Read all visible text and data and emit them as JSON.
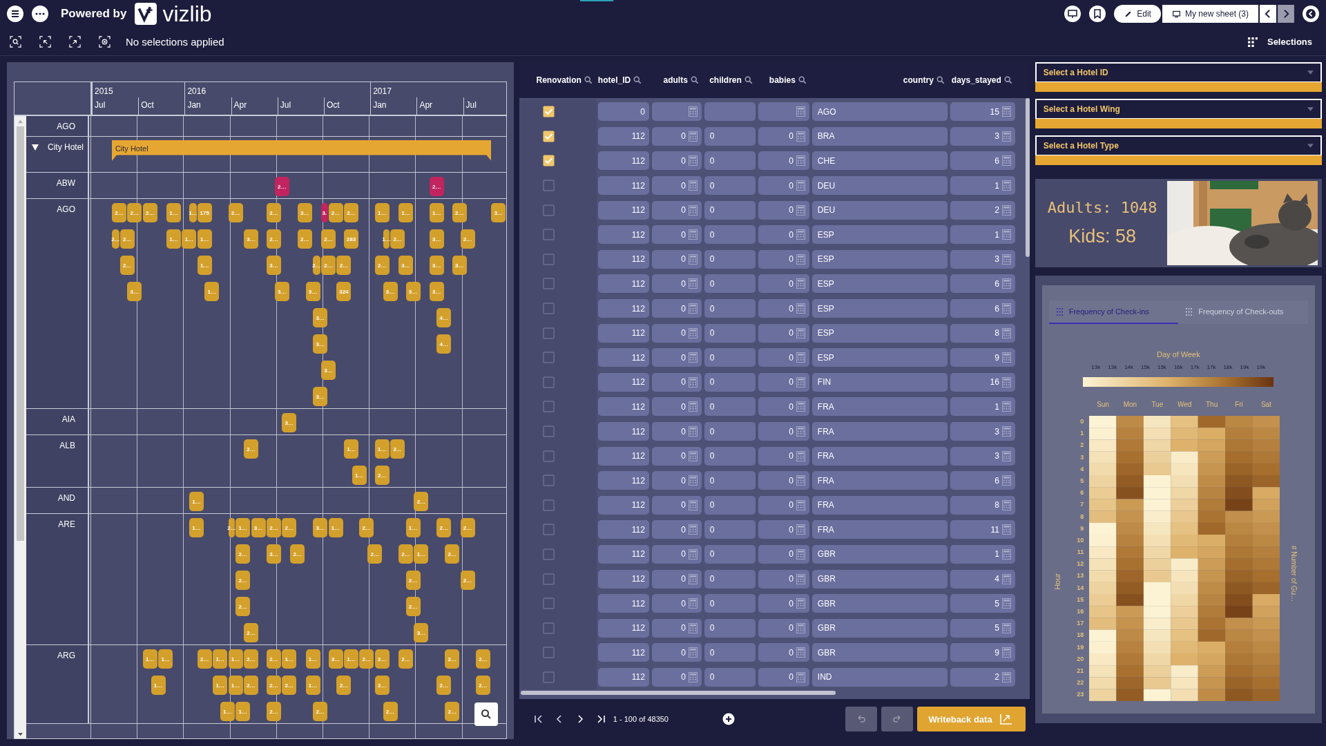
{
  "top_bar": {
    "powered_by": "Powered by",
    "logo_text": "vizlib",
    "edit_label": "Edit",
    "sheet_label": "My new sheet (3)"
  },
  "toolbar": {
    "selection_status": "No selections applied",
    "selections_label": "Selections"
  },
  "gantt": {
    "years": [
      "2015",
      "2016",
      "2017"
    ],
    "months": [
      "Jul",
      "Oct",
      "Jan",
      "Apr",
      "Jul",
      "Oct",
      "Jan",
      "Apr",
      "Jul"
    ],
    "rows": [
      {
        "kind": "country",
        "label": "AGO"
      },
      {
        "kind": "group",
        "label": "City Hotel",
        "expanded": true,
        "group_bar": {
          "label": "City Hotel"
        }
      },
      {
        "kind": "country",
        "label": "ABW",
        "lanes": [
          [
            {
              "label": "2…",
              "color": "#c2245f"
            },
            {
              "label": "2…",
              "color": "#c2245f"
            }
          ]
        ]
      },
      {
        "kind": "country",
        "label": "AGO",
        "lanes": [
          [
            {
              "label": "2…",
              "color": "#d4a02c"
            },
            {
              "label": "2…",
              "color": "#d4a02c"
            },
            {
              "label": "2…",
              "color": "#d4a02c"
            },
            {
              "label": "1…",
              "color": "#d4a02c"
            },
            {
              "label": "1…",
              "color": "#d4a02c"
            },
            {
              "label": "175",
              "color": "#d4a02c"
            },
            {
              "label": "2…",
              "color": "#d4a02c"
            },
            {
              "label": "2…",
              "color": "#d4a02c"
            },
            {
              "label": "3…",
              "color": "#d4a02c"
            },
            {
              "label": "3.",
              "color": "#c2245f"
            },
            {
              "label": "2…",
              "color": "#d4a02c"
            },
            {
              "label": "2…",
              "color": "#d4a02c"
            },
            {
              "label": "1…",
              "color": "#d4a02c"
            },
            {
              "label": "1…",
              "color": "#d4a02c"
            },
            {
              "label": "1…",
              "color": "#d4a02c"
            },
            {
              "label": "2…",
              "color": "#d4a02c"
            },
            {
              "label": "3…",
              "color": "#d4a02c"
            }
          ],
          [
            {
              "label": "2…",
              "color": "#d4a02c"
            },
            {
              "label": "2…",
              "color": "#d4a02c"
            },
            {
              "label": "1…",
              "color": "#d4a02c"
            },
            {
              "label": "1…",
              "color": "#d4a02c"
            },
            {
              "label": "1…",
              "color": "#d4a02c"
            },
            {
              "label": "3…",
              "color": "#d4a02c"
            },
            {
              "label": "2…",
              "color": "#d4a02c"
            },
            {
              "label": "2…",
              "color": "#d4a02c"
            },
            {
              "label": "2…",
              "color": "#d4a02c"
            },
            {
              "label": "283",
              "color": "#d4a02c"
            },
            {
              "label": "1…",
              "color": "#d4a02c"
            },
            {
              "label": "2…",
              "color": "#d4a02c"
            },
            {
              "label": "3…",
              "color": "#d4a02c"
            },
            {
              "label": "2…",
              "color": "#d4a02c"
            }
          ],
          [
            {
              "label": "2…",
              "color": "#d4a02c"
            },
            {
              "label": "1…",
              "color": "#d4a02c"
            },
            {
              "label": "3…",
              "color": "#d4a02c"
            },
            {
              "label": "2…",
              "color": "#d4a02c"
            },
            {
              "label": "2…",
              "color": "#d4a02c"
            },
            {
              "label": "2…",
              "color": "#d4a02c"
            },
            {
              "label": "2…",
              "color": "#d4a02c"
            },
            {
              "label": "3…",
              "color": "#d4a02c"
            },
            {
              "label": "3…",
              "color": "#d4a02c"
            },
            {
              "label": "3…",
              "color": "#d4a02c"
            }
          ],
          [
            {
              "label": "3…",
              "color": "#d4a02c"
            },
            {
              "label": "1…",
              "color": "#d4a02c"
            },
            {
              "label": "3…",
              "color": "#d4a02c"
            },
            {
              "label": "3…",
              "color": "#d4a02c"
            },
            {
              "label": "324",
              "color": "#d4a02c"
            },
            {
              "label": "3…",
              "color": "#d4a02c"
            },
            {
              "label": "3…",
              "color": "#d4a02c"
            },
            {
              "label": "3…",
              "color": "#d4a02c"
            }
          ],
          [
            {
              "label": "3…",
              "color": "#d4a02c"
            },
            {
              "label": "4…",
              "color": "#d4a02c"
            }
          ],
          [
            {
              "label": "3…",
              "color": "#d4a02c"
            },
            {
              "label": "4…",
              "color": "#d4a02c"
            }
          ],
          [
            {
              "label": "3…",
              "color": "#d4a02c"
            }
          ],
          [
            {
              "label": "3…",
              "color": "#d4a02c"
            }
          ]
        ]
      },
      {
        "kind": "country",
        "label": "AIA",
        "lanes": [
          [
            {
              "label": "3…",
              "color": "#d4a02c"
            }
          ]
        ]
      },
      {
        "kind": "country",
        "label": "ALB",
        "lanes": [
          [
            {
              "label": "2…",
              "color": "#d4a02c"
            },
            {
              "label": "1…",
              "color": "#d4a02c"
            },
            {
              "label": "1…",
              "color": "#d4a02c"
            },
            {
              "label": "2…",
              "color": "#d4a02c"
            }
          ],
          [
            {
              "label": "1…",
              "color": "#d4a02c"
            },
            {
              "label": "2…",
              "color": "#d4a02c"
            }
          ]
        ]
      },
      {
        "kind": "country",
        "label": "AND",
        "lanes": [
          [
            {
              "label": "1…",
              "color": "#d4a02c"
            },
            {
              "label": "2…",
              "color": "#d4a02c"
            }
          ]
        ]
      },
      {
        "kind": "country",
        "label": "ARE",
        "lanes": [
          [
            {
              "label": "1…",
              "color": "#d4a02c"
            },
            {
              "label": "2…",
              "color": "#d4a02c"
            },
            {
              "label": "1…",
              "color": "#d4a02c"
            },
            {
              "label": "3…",
              "color": "#d4a02c"
            },
            {
              "label": "2…",
              "color": "#d4a02c"
            },
            {
              "label": "2…",
              "color": "#d4a02c"
            },
            {
              "label": "3…",
              "color": "#d4a02c"
            },
            {
              "label": "1…",
              "color": "#d4a02c"
            },
            {
              "label": "2…",
              "color": "#d4a02c"
            },
            {
              "label": "1…",
              "color": "#d4a02c"
            },
            {
              "label": "2…",
              "color": "#d4a02c"
            },
            {
              "label": "2…",
              "color": "#d4a02c"
            }
          ],
          [
            {
              "label": "2…",
              "color": "#d4a02c"
            },
            {
              "label": "3…",
              "color": "#d4a02c"
            },
            {
              "label": "2…",
              "color": "#d4a02c"
            },
            {
              "label": "2…",
              "color": "#d4a02c"
            },
            {
              "label": "2…",
              "color": "#d4a02c"
            },
            {
              "label": "1…",
              "color": "#d4a02c"
            },
            {
              "label": "2…",
              "color": "#d4a02c"
            }
          ],
          [
            {
              "label": "2…",
              "color": "#d4a02c"
            },
            {
              "label": "2…",
              "color": "#d4a02c"
            },
            {
              "label": "2…",
              "color": "#d4a02c"
            }
          ],
          [
            {
              "label": "2…",
              "color": "#d4a02c"
            },
            {
              "label": "2…",
              "color": "#d4a02c"
            }
          ],
          [
            {
              "label": "2…",
              "color": "#d4a02c"
            },
            {
              "label": "3…",
              "color": "#d4a02c"
            }
          ]
        ]
      },
      {
        "kind": "country",
        "label": "ARG",
        "lanes": [
          [
            {
              "label": "1…",
              "color": "#d4a02c"
            },
            {
              "label": "1…",
              "color": "#d4a02c"
            },
            {
              "label": "2…",
              "color": "#d4a02c"
            },
            {
              "label": "1…",
              "color": "#d4a02c"
            },
            {
              "label": "1…",
              "color": "#d4a02c"
            },
            {
              "label": "2…",
              "color": "#d4a02c"
            },
            {
              "label": "2…",
              "color": "#d4a02c"
            },
            {
              "label": "1…",
              "color": "#d4a02c"
            },
            {
              "label": "1…",
              "color": "#d4a02c"
            },
            {
              "label": "3…",
              "color": "#d4a02c"
            },
            {
              "label": "1…",
              "color": "#d4a02c"
            },
            {
              "label": "2…",
              "color": "#d4a02c"
            },
            {
              "label": "2…",
              "color": "#d4a02c"
            },
            {
              "label": "2…",
              "color": "#d4a02c"
            },
            {
              "label": "2…",
              "color": "#d4a02c"
            },
            {
              "label": "2…",
              "color": "#d4a02c"
            }
          ],
          [
            {
              "label": "1…",
              "color": "#d4a02c"
            },
            {
              "label": "1…",
              "color": "#d4a02c"
            },
            {
              "label": "1…",
              "color": "#d4a02c"
            },
            {
              "label": "2…",
              "color": "#d4a02c"
            },
            {
              "label": "2…",
              "color": "#d4a02c"
            },
            {
              "label": "2…",
              "color": "#d4a02c"
            },
            {
              "label": "1…",
              "color": "#d4a02c"
            },
            {
              "label": "2…",
              "color": "#d4a02c"
            },
            {
              "label": "2…",
              "color": "#d4a02c"
            },
            {
              "label": "2…",
              "color": "#d4a02c"
            },
            {
              "label": "2…",
              "color": "#d4a02c"
            }
          ],
          [
            {
              "label": "1…",
              "color": "#d4a02c"
            },
            {
              "label": "1…",
              "color": "#d4a02c"
            },
            {
              "label": "2…",
              "color": "#d4a02c"
            },
            {
              "label": "2…",
              "color": "#d4a02c"
            },
            {
              "label": "2…",
              "color": "#d4a02c"
            },
            {
              "label": "2…",
              "color": "#d4a02c"
            }
          ]
        ]
      }
    ]
  },
  "table": {
    "check_column": {
      "label": "Renovation"
    },
    "columns": [
      {
        "label": "hotel_ID",
        "kind": "number"
      },
      {
        "label": "adults",
        "kind": "calc"
      },
      {
        "label": "children",
        "kind": "text"
      },
      {
        "label": "babies",
        "kind": "calc"
      },
      {
        "label": "country",
        "kind": "text"
      },
      {
        "label": "days_stayed",
        "kind": "calc"
      }
    ],
    "rows": [
      {
        "checked": true,
        "cells": [
          "0",
          null,
          null,
          null,
          "AGO",
          "15"
        ]
      },
      {
        "checked": true,
        "cells": [
          "112",
          "0",
          "0",
          "0",
          "BRA",
          "3"
        ]
      },
      {
        "checked": true,
        "cells": [
          "112",
          "0",
          "0",
          "0",
          "CHE",
          "6"
        ]
      },
      {
        "checked": false,
        "cells": [
          "112",
          "0",
          "0",
          "0",
          "DEU",
          "1"
        ]
      },
      {
        "checked": false,
        "cells": [
          "112",
          "0",
          "0",
          "0",
          "DEU",
          "2"
        ]
      },
      {
        "checked": false,
        "cells": [
          "112",
          "0",
          "0",
          "0",
          "ESP",
          "1"
        ]
      },
      {
        "checked": false,
        "cells": [
          "112",
          "0",
          "0",
          "0",
          "ESP",
          "3"
        ]
      },
      {
        "checked": false,
        "cells": [
          "112",
          "0",
          "0",
          "0",
          "ESP",
          "6"
        ]
      },
      {
        "checked": false,
        "cells": [
          "112",
          "0",
          "0",
          "0",
          "ESP",
          "6"
        ]
      },
      {
        "checked": false,
        "cells": [
          "112",
          "0",
          "0",
          "0",
          "ESP",
          "8"
        ]
      },
      {
        "checked": false,
        "cells": [
          "112",
          "0",
          "0",
          "0",
          "ESP",
          "9"
        ]
      },
      {
        "checked": false,
        "cells": [
          "112",
          "0",
          "0",
          "0",
          "FIN",
          "16"
        ]
      },
      {
        "checked": false,
        "cells": [
          "112",
          "0",
          "0",
          "0",
          "FRA",
          "1"
        ]
      },
      {
        "checked": false,
        "cells": [
          "112",
          "0",
          "0",
          "0",
          "FRA",
          "3"
        ]
      },
      {
        "checked": false,
        "cells": [
          "112",
          "0",
          "0",
          "0",
          "FRA",
          "3"
        ]
      },
      {
        "checked": false,
        "cells": [
          "112",
          "0",
          "0",
          "0",
          "FRA",
          "6"
        ]
      },
      {
        "checked": false,
        "cells": [
          "112",
          "0",
          "0",
          "0",
          "FRA",
          "8"
        ]
      },
      {
        "checked": false,
        "cells": [
          "112",
          "0",
          "0",
          "0",
          "FRA",
          "11"
        ]
      },
      {
        "checked": false,
        "cells": [
          "112",
          "0",
          "0",
          "0",
          "GBR",
          "1"
        ]
      },
      {
        "checked": false,
        "cells": [
          "112",
          "0",
          "0",
          "0",
          "GBR",
          "4"
        ]
      },
      {
        "checked": false,
        "cells": [
          "112",
          "0",
          "0",
          "0",
          "GBR",
          "5"
        ]
      },
      {
        "checked": false,
        "cells": [
          "112",
          "0",
          "0",
          "0",
          "GBR",
          "5"
        ]
      },
      {
        "checked": false,
        "cells": [
          "112",
          "0",
          "0",
          "0",
          "GBR",
          "9"
        ]
      },
      {
        "checked": false,
        "cells": [
          "112",
          "0",
          "0",
          "0",
          "IND",
          "2"
        ]
      }
    ],
    "pagination": "1 - 100 of 48350",
    "undo": {
      "disabled": true
    },
    "redo": {
      "disabled": true
    },
    "writeback_label": "Writeback data"
  },
  "filters": [
    {
      "placeholder": "Select a Hotel ID"
    },
    {
      "placeholder": "Select a Hotel Wing"
    },
    {
      "placeholder": "Select a Hotel Type"
    }
  ],
  "kpi": {
    "adults": "Adults: 1048",
    "kids": "Kids: 58"
  },
  "heatmap": {
    "tabs": [
      {
        "label": "Frequency of Check-ins",
        "selected": true
      },
      {
        "label": "Frequency of Check-outs",
        "selected": false
      }
    ],
    "x_title": "Day of Week",
    "y_title": "Hour",
    "legend_title": "# Number of Gu…",
    "legend_ticks": [
      "13k",
      "13k",
      "14k",
      "15k",
      "15k",
      "16k",
      "17k",
      "17k",
      "18k",
      "19k",
      "19k"
    ],
    "days": [
      "Sun",
      "Mon",
      "Tue",
      "Wed",
      "Thu",
      "Fri",
      "Sat"
    ],
    "hours": [
      "0",
      "1",
      "2",
      "3",
      "4",
      "5",
      "6",
      "7",
      "8",
      "9",
      "10",
      "11",
      "12",
      "13",
      "14",
      "15",
      "16",
      "17",
      "18",
      "19",
      "20",
      "21",
      "22",
      "23"
    ]
  }
}
